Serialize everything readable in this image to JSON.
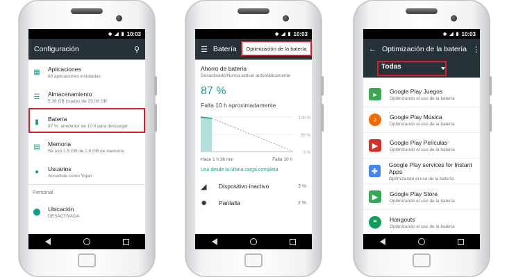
{
  "status": {
    "time": "10:03"
  },
  "screen1": {
    "title": "Configuración",
    "items": [
      {
        "title": "Aplicaciones",
        "subtitle": "60 aplicaciones instaladas"
      },
      {
        "title": "Almacenamiento",
        "subtitle": "5.36 GB usados de 29.08 GB"
      },
      {
        "title": "Batería",
        "subtitle": "87 %: alrededor de 10 h para descargar"
      },
      {
        "title": "Memoria",
        "subtitle": "Se usó 1.5 GB de 1.8 GB de memoria"
      },
      {
        "title": "Usuarios",
        "subtitle": "Accediste como Yojan"
      }
    ],
    "section": "Personal",
    "location": {
      "title": "Ubicación",
      "subtitle": "DESACTIVADA"
    }
  },
  "screen2": {
    "title": "Batería",
    "menu_option": "Optimización de la batería",
    "saver_title": "Ahorro de batería",
    "saver_subtitle": "Desactivado/Nunca activar automáticamente",
    "percent": "87 %",
    "remaining": "Falta 10 h aproximadamente",
    "graph_labels": {
      "y100": "100 %",
      "y50": "50 %",
      "y0": "0 %",
      "x_start": "Hace 1 h 36 min",
      "x_end": "Falta 10 h"
    },
    "usage_title": "Uso desde la última carga completa",
    "usage": [
      {
        "name": "Dispositivo inactivo",
        "value": "3 %",
        "icon": "signal-icon"
      },
      {
        "name": "Pantalla",
        "value": "2 %",
        "icon": "brightness-icon"
      }
    ]
  },
  "screen3": {
    "title": "Optimización de la batería",
    "filter": "Todas",
    "apps": [
      {
        "name": "Google Play Juegos",
        "subtitle": "Optimizando el uso de la batería",
        "color": "#3aa757"
      },
      {
        "name": "Google Play Música",
        "subtitle": "Optimizando el uso de la batería",
        "color": "#ef6c00"
      },
      {
        "name": "Google Play Películas",
        "subtitle": "Optimizando el uso de la batería",
        "color": "#d32f2f"
      },
      {
        "name": "Google Play services for Instant Apps",
        "subtitle": "Optimizando el uso de la batería",
        "color": "#4285f4"
      },
      {
        "name": "Google Play Store",
        "subtitle": "Optimizando el uso de la batería",
        "color": "#34a853"
      },
      {
        "name": "Hangouts",
        "subtitle": "Optimizando el uso de la batería",
        "color": "#0f9d58"
      }
    ]
  },
  "colors": {
    "accent": "#1a9b8e",
    "appbar": "#263238",
    "highlight": "#d61f2b"
  }
}
